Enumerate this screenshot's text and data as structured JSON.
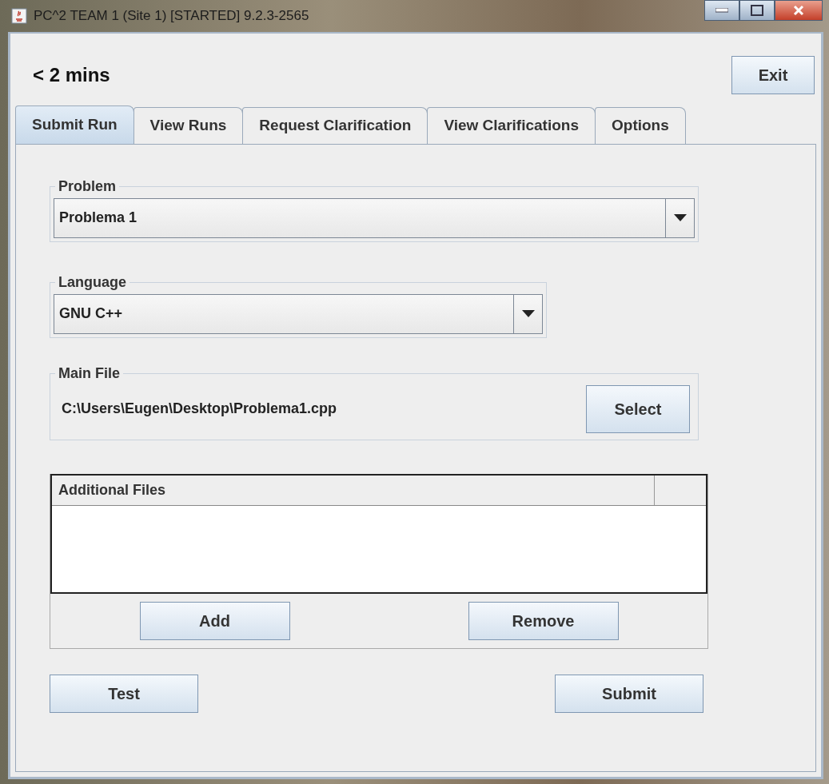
{
  "window": {
    "title": "PC^2 TEAM 1 (Site 1) [STARTED] 9.2.3-2565"
  },
  "clock": "< 2 mins",
  "exit_button": "Exit",
  "tabs": [
    {
      "label": "Submit Run",
      "selected": true
    },
    {
      "label": "View Runs",
      "selected": false
    },
    {
      "label": "Request Clarification",
      "selected": false
    },
    {
      "label": "View Clarifications",
      "selected": false
    },
    {
      "label": "Options",
      "selected": false
    }
  ],
  "problem": {
    "label": "Problem",
    "value": "Problema 1"
  },
  "language": {
    "label": "Language",
    "value": "GNU C++"
  },
  "main_file": {
    "label": "Main File",
    "path": "C:\\Users\\Eugen\\Desktop\\Problema1.cpp",
    "button": "Select"
  },
  "additional_files": {
    "columns": [
      "Additional Files"
    ],
    "buttons": [
      "Add",
      "Remove"
    ]
  },
  "buttons": [
    "Test",
    "Submit"
  ]
}
